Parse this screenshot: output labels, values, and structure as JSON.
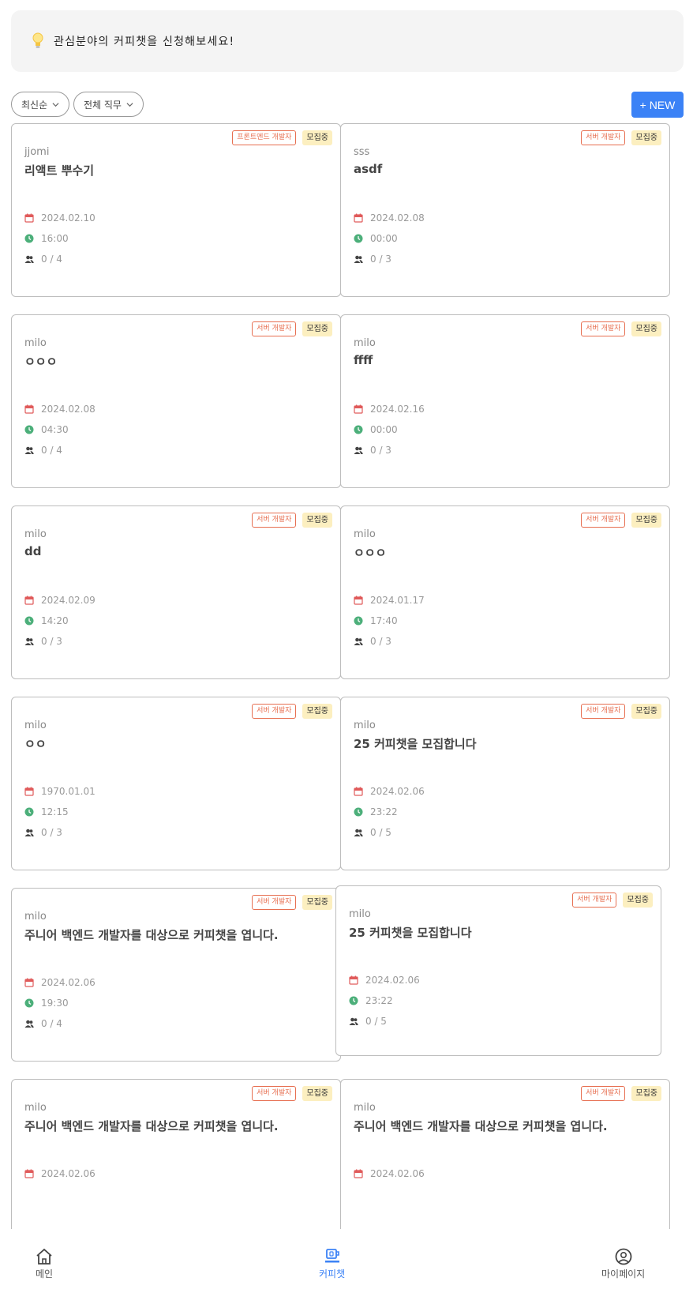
{
  "banner": {
    "text": "관심분야의 커피챗을 신청해보세요!"
  },
  "filters": {
    "sort": "최신순",
    "job": "전체 직무"
  },
  "new_button": "+ NEW",
  "cards": [
    {
      "job": "프론트엔드 개발자",
      "status": "모집중",
      "author": "jjomi",
      "title": "리액트 뿌수기",
      "date": "2024.02.10",
      "time": "16:00",
      "people": "0 / 4"
    },
    {
      "job": "서버 개발자",
      "status": "모집중",
      "author": "sss",
      "title": "asdf",
      "date": "2024.02.08",
      "time": "00:00",
      "people": "0 / 3"
    },
    {
      "job": "서버 개발자",
      "status": "모집중",
      "author": "milo",
      "title": "ㅇㅇㅇ",
      "date": "2024.02.08",
      "time": "04:30",
      "people": "0 / 4"
    },
    {
      "job": "서버 개발자",
      "status": "모집중",
      "author": "milo",
      "title": "ffff",
      "date": "2024.02.16",
      "time": "00:00",
      "people": "0 / 3"
    },
    {
      "job": "서버 개발자",
      "status": "모집중",
      "author": "milo",
      "title": "dd",
      "date": "2024.02.09",
      "time": "14:20",
      "people": "0 / 3"
    },
    {
      "job": "서버 개발자",
      "status": "모집중",
      "author": "milo",
      "title": "ㅇㅇㅇ",
      "date": "2024.01.17",
      "time": "17:40",
      "people": "0 / 3"
    },
    {
      "job": "서버 개발자",
      "status": "모집중",
      "author": "milo",
      "title": "ㅇㅇ",
      "date": "1970.01.01",
      "time": "12:15",
      "people": "0 / 3"
    },
    {
      "job": "서버 개발자",
      "status": "모집중",
      "author": "milo",
      "title": "25 커피챗을 모집합니다",
      "date": "2024.02.06",
      "time": "23:22",
      "people": "0 / 5"
    },
    {
      "job": "서버 개발자",
      "status": "모집중",
      "author": "milo",
      "title": "주니어 백엔드 개발자를 대상으로 커피챗을 엽니다.",
      "date": "2024.02.06",
      "time": "19:30",
      "people": "0 / 4"
    },
    {
      "job": "서버 개발자",
      "status": "모집중",
      "author": "milo",
      "title": "25 커피챗을 모집합니다",
      "date": "2024.02.06",
      "time": "23:22",
      "people": "0 / 5"
    },
    {
      "job": "서버 개발자",
      "status": "모집중",
      "author": "milo",
      "title": "주니어 백엔드 개발자를 대상으로 커피챗을 엽니다.",
      "date": "2024.02.06",
      "time": "",
      "people": ""
    },
    {
      "job": "서버 개발자",
      "status": "모집중",
      "author": "milo",
      "title": "주니어 백엔드 개발자를 대상으로 커피챗을 엽니다.",
      "date": "2024.02.06",
      "time": "",
      "people": ""
    }
  ],
  "nav": {
    "home": "메인",
    "coffeechat": "커피챗",
    "mypage": "마이페이지"
  },
  "colors": {
    "accent": "#3b82f6",
    "tag_job": "#e76f51",
    "tag_status_bg": "#fcefc0",
    "date_icon": "#e05a5a",
    "time_icon": "#4caf7a"
  },
  "icons": {
    "banner": "lightbulb-icon",
    "date": "calendar-icon",
    "time": "clock-icon",
    "people": "people-icon",
    "home": "home-icon",
    "coffeechat": "coffee-cup-icon",
    "mypage": "user-circle-icon"
  }
}
